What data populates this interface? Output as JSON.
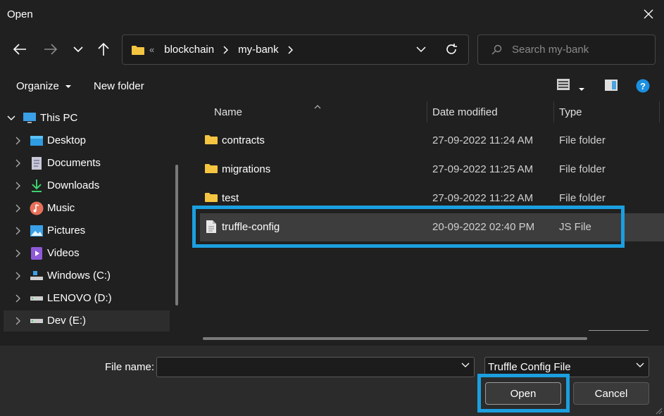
{
  "window": {
    "title": "Open"
  },
  "address": {
    "crumbs": [
      "blockchain",
      "my-bank"
    ],
    "overflow": "«"
  },
  "search": {
    "placeholder": "Search my-bank"
  },
  "toolbar": {
    "organize": "Organize",
    "new_folder": "New folder"
  },
  "sidebar": {
    "items": [
      {
        "label": "This PC",
        "icon": "computer-icon"
      },
      {
        "label": "Desktop",
        "icon": "desktop-icon"
      },
      {
        "label": "Documents",
        "icon": "documents-icon"
      },
      {
        "label": "Downloads",
        "icon": "download-icon"
      },
      {
        "label": "Music",
        "icon": "music-icon"
      },
      {
        "label": "Pictures",
        "icon": "pictures-icon"
      },
      {
        "label": "Videos",
        "icon": "videos-icon"
      },
      {
        "label": "Windows (C:)",
        "icon": "drive-icon"
      },
      {
        "label": "LENOVO (D:)",
        "icon": "drive-icon"
      },
      {
        "label": "Dev (E:)",
        "icon": "drive-icon"
      }
    ]
  },
  "columns": {
    "name": "Name",
    "date": "Date modified",
    "type": "Type"
  },
  "files": [
    {
      "name": "contracts",
      "date": "27-09-2022 11:24 AM",
      "type": "File folder",
      "icon": "folder-icon"
    },
    {
      "name": "migrations",
      "date": "27-09-2022 11:25 AM",
      "type": "File folder",
      "icon": "folder-icon"
    },
    {
      "name": "test",
      "date": "27-09-2022 11:22 AM",
      "type": "File folder",
      "icon": "folder-icon"
    },
    {
      "name": "truffle-config",
      "date": "20-09-2022 02:40 PM",
      "type": "JS File",
      "icon": "file-icon"
    }
  ],
  "bottom": {
    "file_name_label": "File name:",
    "file_name_value": "",
    "file_type": "Truffle Config File",
    "open_label": "Open",
    "cancel_label": "Cancel"
  },
  "colors": {
    "accent": "#1b9fe0",
    "folder": "#f5c542",
    "background": "#202020"
  }
}
